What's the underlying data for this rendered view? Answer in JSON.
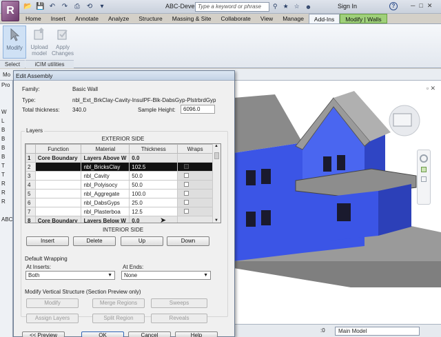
{
  "app": {
    "logo_letter": "R",
    "doc_title": "ABC-Develo...",
    "search_placeholder": "Type a keyword or phrase",
    "sign_in": "Sign In",
    "help": "?"
  },
  "tabs": [
    "Home",
    "Insert",
    "Annotate",
    "Analyze",
    "Structure",
    "Massing & Site",
    "Collaborate",
    "View",
    "Manage",
    "Add-Ins",
    "Modify | Walls"
  ],
  "ribbon": {
    "modify": "Modify",
    "upload_model": "Upload model",
    "apply_changes": "Apply Changes",
    "select_panel": "Select",
    "icim_panel": "iCIM utilities"
  },
  "options_bar": {
    "text": "Mo"
  },
  "left_strip": [
    "Pro",
    "",
    "",
    "W",
    "L",
    "B",
    "B",
    "B",
    "B",
    "T",
    "T",
    "R",
    "R",
    "R",
    "",
    "ABC"
  ],
  "dialog": {
    "title": "Edit Assembly",
    "family_label": "Family:",
    "family_value": "Basic Wall",
    "type_label": "Type:",
    "type_value": "nbl_Ext_BrkClay-Cavity-InsulPF-Blk-DabsGyp-PlstrbrdGyp",
    "thickness_label": "Total thickness:",
    "thickness_value": "340.0",
    "sample_height_label": "Sample Height:",
    "sample_height_value": "6096.0",
    "layers_title": "Layers",
    "exterior_side": "EXTERIOR SIDE",
    "interior_side": "INTERIOR SIDE",
    "columns": [
      "Function",
      "Material",
      "Thickness",
      "Wraps"
    ],
    "rows": [
      {
        "num": "1",
        "function": "Core Boundary",
        "material": "Layers Above W",
        "thickness": "0.0",
        "bold": true
      },
      {
        "num": "2",
        "function": "",
        "material": "nbl_BricksClay",
        "thickness": "102.5",
        "selected": true
      },
      {
        "num": "3",
        "function": "",
        "material": "nbl_Cavity",
        "thickness": "50.0"
      },
      {
        "num": "4",
        "function": "",
        "material": "nbl_Polyisocy",
        "thickness": "50.0"
      },
      {
        "num": "5",
        "function": "",
        "material": "nbl_Aggregate",
        "thickness": "100.0"
      },
      {
        "num": "6",
        "function": "",
        "material": "nbl_DabsGyps",
        "thickness": "25.0"
      },
      {
        "num": "7",
        "function": "",
        "material": "nbl_Plasterboa",
        "thickness": "12.5"
      },
      {
        "num": "8",
        "function": "Core Boundary",
        "material": "Layers Below W",
        "thickness": "0.0",
        "bold": true
      }
    ],
    "insert": "Insert",
    "delete": "Delete",
    "up": "Up",
    "down": "Down",
    "default_wrapping": "Default Wrapping",
    "at_inserts_label": "At Inserts:",
    "at_inserts_value": "Both",
    "at_ends_label": "At Ends:",
    "at_ends_value": "None",
    "modify_vertical": "Modify Vertical Structure (Section Preview only)",
    "modify": "Modify",
    "merge_regions": "Merge Regions",
    "sweeps": "Sweeps",
    "assign_layers": "Assign Layers",
    "split_region": "Split Region",
    "reveals": "Reveals",
    "preview": "<< Preview",
    "ok": "OK",
    "cancel": "Cancel",
    "help": "Help"
  },
  "status": {
    "zero": ":0",
    "main_model": "Main Model"
  },
  "colors": {
    "wall_blue": "#3b55e6",
    "roof_gray": "#8d8d8d",
    "context_tab": "#9fd07a"
  }
}
